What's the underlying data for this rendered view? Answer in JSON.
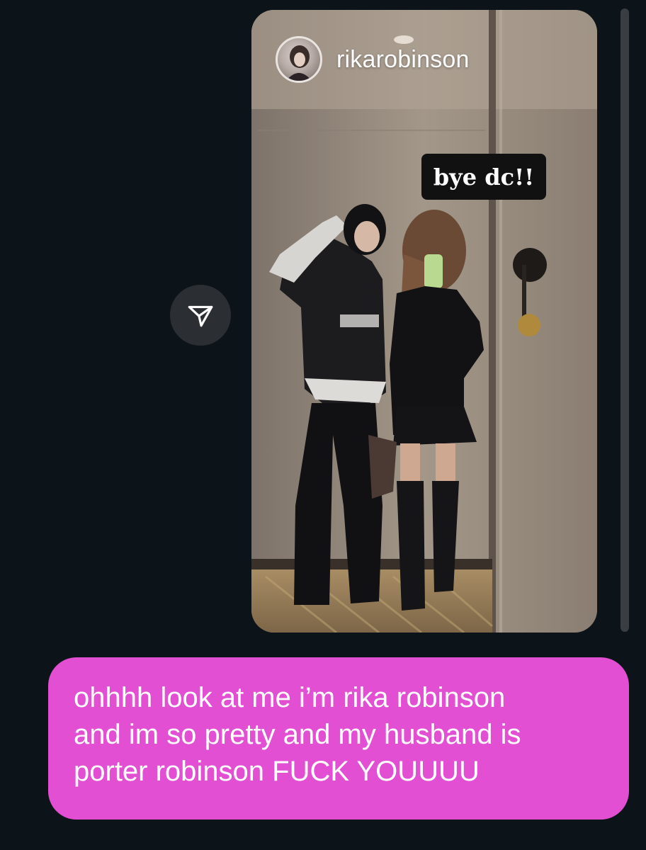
{
  "story": {
    "username": "rikarobinson",
    "sticker_text": "bye dc!!",
    "avatar_icon": "avatar-photo"
  },
  "actions": {
    "share_icon": "send-paper-plane-icon"
  },
  "message": {
    "text": "ohhhh look at me i’m rika robinson\nand im so pretty and my husband is\nporter robinson FUCK YOUUUU",
    "bubble_color": "#e24fd2"
  },
  "colors": {
    "background": "#0d1419",
    "share_button": "#2b2f33",
    "scrollbar": "#3a3d41"
  }
}
